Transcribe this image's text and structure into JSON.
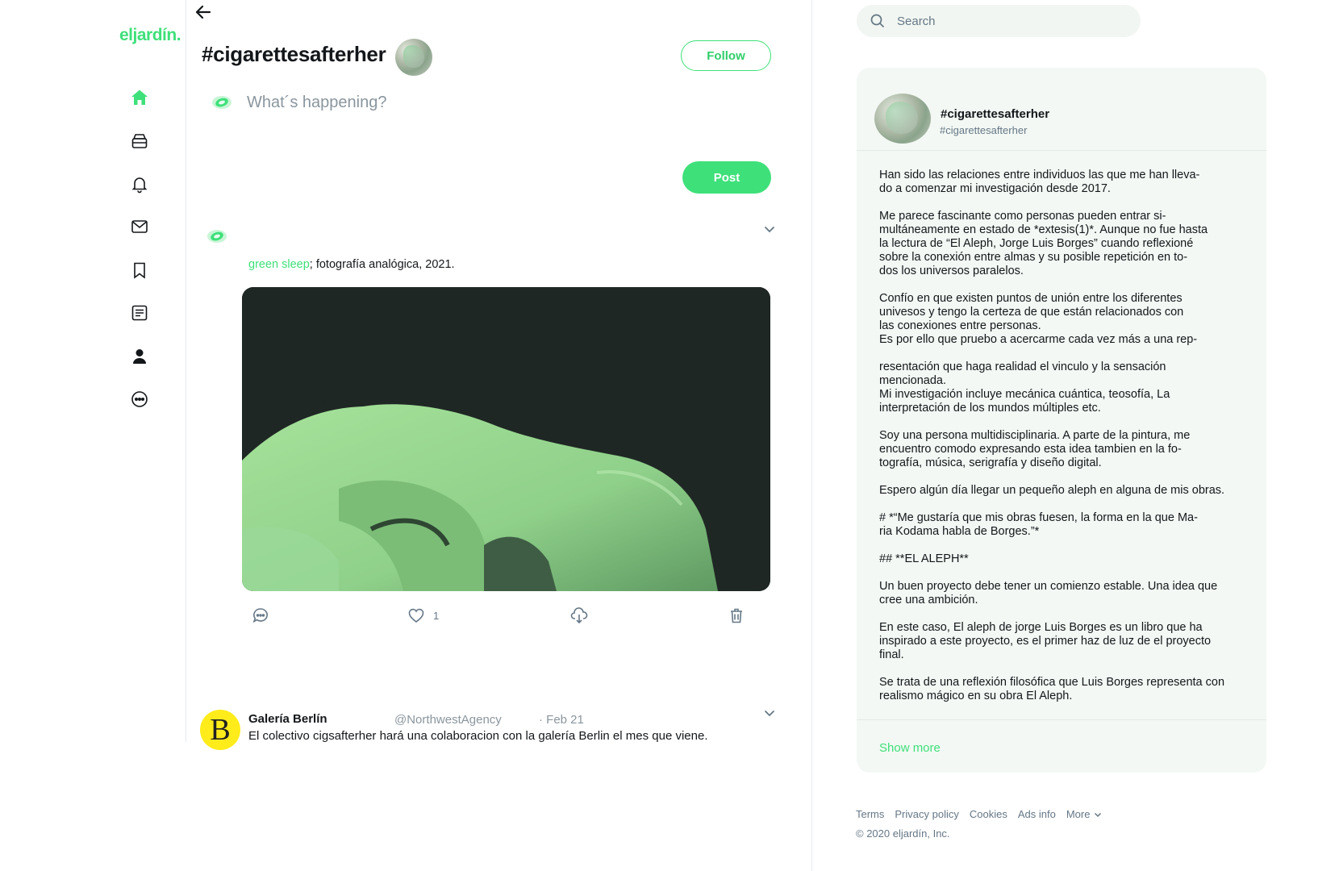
{
  "app": {
    "logo": "eljardín."
  },
  "nav": {
    "items": [
      {
        "name": "home",
        "icon": "home-icon",
        "active": true
      },
      {
        "name": "explore",
        "icon": "archive-icon"
      },
      {
        "name": "notifications",
        "icon": "bell-icon"
      },
      {
        "name": "messages",
        "icon": "mail-icon"
      },
      {
        "name": "bookmarks",
        "icon": "bookmark-icon"
      },
      {
        "name": "lists",
        "icon": "list-icon"
      },
      {
        "name": "profile",
        "icon": "user-icon"
      },
      {
        "name": "more",
        "icon": "more-icon"
      }
    ]
  },
  "header": {
    "title": "#cigarettesafterher",
    "follow_label": "Follow"
  },
  "compose": {
    "placeholder": "What´s happening?",
    "post_label": "Post"
  },
  "tweet1": {
    "caption_link": "green sleep",
    "caption_rest": "; fotografía analógica, 2021.",
    "like_count": "1"
  },
  "tweet2": {
    "avatar_letter": "B",
    "name": "Galería Berlín",
    "handle": "@NorthwestAgency",
    "date": "· Feb 21",
    "text": "El colectivo cigsafterher hará una colaboracion con la galería Berlin el mes que viene."
  },
  "search": {
    "placeholder": "Search"
  },
  "panel": {
    "name": "#cigarettesafterher",
    "handle": "#cigarettesafterher",
    "paragraphs": [
      "Han sido las relaciones entre individuos las que me han lleva-\ndo a comenzar mi investigación desde 2017.",
      "Me parece fascinante como personas pueden entrar si-\nmultáneamente en estado de *extesis(1)*. Aunque no fue hasta\nla lectura de “El Aleph, Jorge Luis Borges” cuando reflexioné\nsobre la conexión entre almas y su posible repetición en to-\ndos los universos paralelos.",
      "Confío en que existen puntos de unión entre los diferentes\nunivesos y tengo la certeza de que están relacionados con\nlas conexiones entre personas.\nEs por ello que pruebo a acercarme cada vez más a una rep-",
      "resentación que haga realidad el vinculo y la sensación\nmencionada.\nMi investigación incluye mecánica cuántica, teosofía, La\ninterpretación de los mundos múltiples etc.",
      "Soy una persona multidisciplinaria. A parte de la pintura, me\nencuentro comodo expresando esta idea tambien en la fo-\ntografía, música, serigrafía y diseño digital.",
      "Espero algún día llegar un pequeño aleph en alguna de mis obras.",
      "# *“Me gustaría que mis obras fuesen, la forma en la que Ma-\nria Kodama habla de Borges.”*",
      "## **EL ALEPH**",
      "Un buen proyecto debe tener un comienzo estable. Una idea que\ncree una ambición.",
      "En este caso, El aleph de jorge Luis Borges es un libro que ha\ninspirado a este proyecto, es el primer haz de luz de el proyecto\nfinal.",
      "Se trata de una reflexión filosófica que Luis Borges representa con\nrealismo mágico en su obra El Aleph."
    ],
    "show_more": "Show more"
  },
  "footer": {
    "links": [
      "Terms",
      "Privacy policy",
      "Cookies",
      "Ads info"
    ],
    "more": "More",
    "copyright": "© 2020 eljardín, Inc."
  },
  "colors": {
    "accent": "#3ee07a",
    "text": "#14171a",
    "muted": "#657786",
    "panel_bg": "#f3f8f4"
  }
}
